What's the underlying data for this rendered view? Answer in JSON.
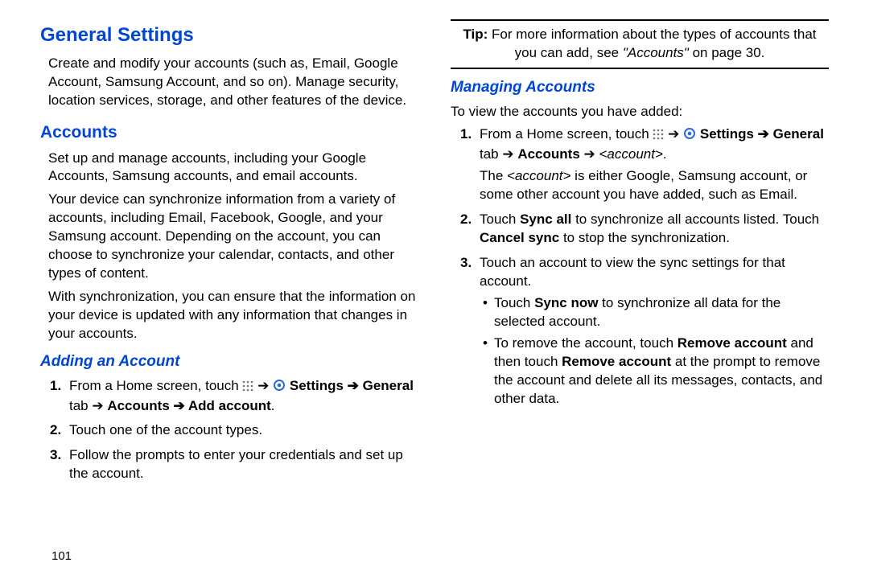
{
  "left": {
    "h1": "General Settings",
    "p1": "Create and modify your accounts (such as, Email, Google Account, Samsung Account, and so on). Manage security, location services, storage, and other features of the device.",
    "h2_accounts": "Accounts",
    "p2": "Set up and manage accounts, including your Google Accounts, Samsung accounts, and email accounts.",
    "p3": "Your device can synchronize information from a variety of accounts, including Email, Facebook, Google, and your Samsung account. Depending on the account, you can choose to synchronize your calendar, contacts, and other types of content.",
    "p4": "With synchronization, you can ensure that the information on your device is updated with any information that changes in your accounts.",
    "h3_adding": "Adding an Account",
    "add_steps": {
      "s1_a": "From a Home screen, touch ",
      "s1_b": " ➔ ",
      "s1_settings": "Settings ➔ ",
      "s1_c": "General",
      "s1_d": " tab ➔ ",
      "s1_e": "Accounts ➔ Add account",
      "s1_f": ".",
      "s2": "Touch one of the account types.",
      "s3": "Follow the prompts to enter your credentials and set up the account."
    }
  },
  "right": {
    "tip_label": "Tip:",
    "tip_a": " For more information about the types of accounts that you can add, see ",
    "tip_ref": "\"Accounts\"",
    "tip_b": " on page 30.",
    "h3_manage": "Managing Accounts",
    "p1": "To view the accounts you have added:",
    "s1_a": "From a Home screen, touch ",
    "s1_b": " ➔ ",
    "s1_settings": "Settings ➔ ",
    "s1_c": "General",
    "s1_d": " tab ➔ ",
    "s1_e": "Accounts",
    "s1_f": " ➔ ",
    "s1_g": "<account>",
    "s1_h": ".",
    "s1_expl_a": "The ",
    "s1_expl_b": "<account>",
    "s1_expl_c": " is either Google, Samsung account, or some other account you have added, such as Email.",
    "s2_a": "Touch ",
    "s2_b": "Sync all",
    "s2_c": " to synchronize all accounts listed. Touch ",
    "s2_d": "Cancel sync",
    "s2_e": " to stop the synchronization.",
    "s3": "Touch an account to view the sync settings for that account.",
    "b1_a": "Touch ",
    "b1_b": "Sync now",
    "b1_c": " to synchronize all data for the selected account.",
    "b2_a": "To remove the account, touch ",
    "b2_b": "Remove account",
    "b2_c": " and then touch ",
    "b2_d": "Remove account",
    "b2_e": " at the prompt to remove the account and delete all its messages, contacts, and other data."
  },
  "page_number": "101"
}
